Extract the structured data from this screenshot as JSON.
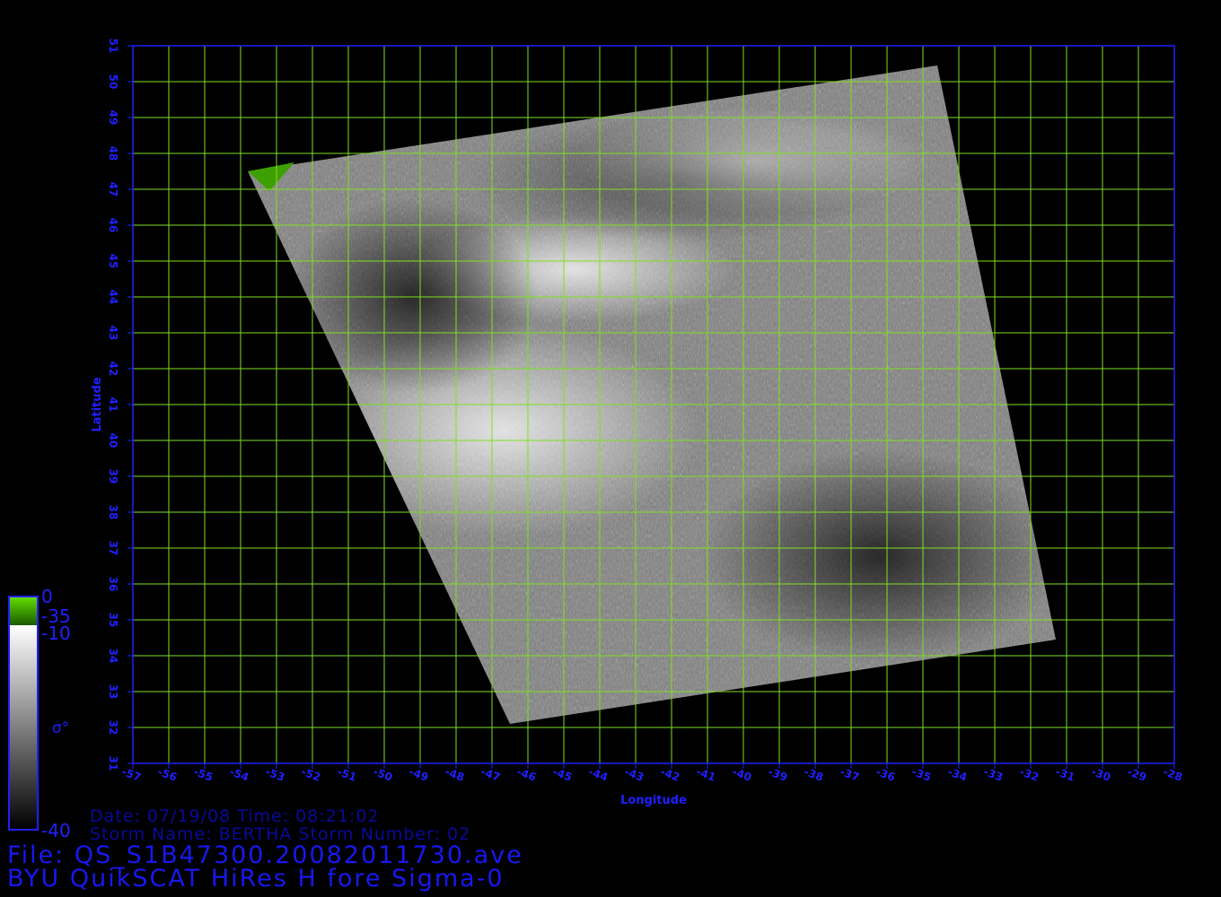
{
  "map": {
    "lon_range": [
      -57,
      -28
    ],
    "lat_range": [
      31,
      51
    ],
    "grid": true,
    "x_ticks": [
      "-57",
      "-56",
      "-55",
      "-54",
      "-53",
      "-52",
      "-51",
      "-50",
      "-49",
      "-48",
      "-47",
      "-46",
      "-45",
      "-44",
      "-43",
      "-42",
      "-41",
      "-40",
      "-39",
      "-38",
      "-37",
      "-36",
      "-35",
      "-34",
      "-33",
      "-32",
      "-31",
      "-30",
      "-29",
      "-28"
    ],
    "y_ticks": [
      "31",
      "32",
      "33",
      "34",
      "35",
      "36",
      "37",
      "38",
      "39",
      "40",
      "41",
      "42",
      "43",
      "44",
      "45",
      "46",
      "47",
      "48",
      "49",
      "50",
      "51"
    ],
    "x_label": "Longitude",
    "y_label": "Latitude",
    "swath_corners_lonlat": [
      [
        -53.8,
        47.5
      ],
      [
        -34.6,
        50.45
      ],
      [
        -31.3,
        34.45
      ],
      [
        -46.5,
        32.1
      ]
    ],
    "colors": {
      "grid": "#7ee020",
      "axis": "#2020ff",
      "land": "#3ea000"
    }
  },
  "colorbar": {
    "labels": {
      "top": "0",
      "green_low": "-35",
      "gray_top": "-10",
      "symbol": "σ°",
      "bottom": "-40"
    },
    "colors": {
      "green_top": "#64e000",
      "green_bottom": "#1a5a00",
      "gray_top": "#ffffff",
      "gray_bottom": "#000000",
      "border": "#2020ff"
    }
  },
  "info": {
    "date_line": "Date: 07/19/08   Time: 08:21:02",
    "storm_line": "Storm  Name: BERTHA   Storm  Number: 02",
    "file_line": "File: QS_S1B47300.20082011730.ave",
    "title_line": "BYU QuikSCAT HiRes H fore Sigma-0"
  }
}
